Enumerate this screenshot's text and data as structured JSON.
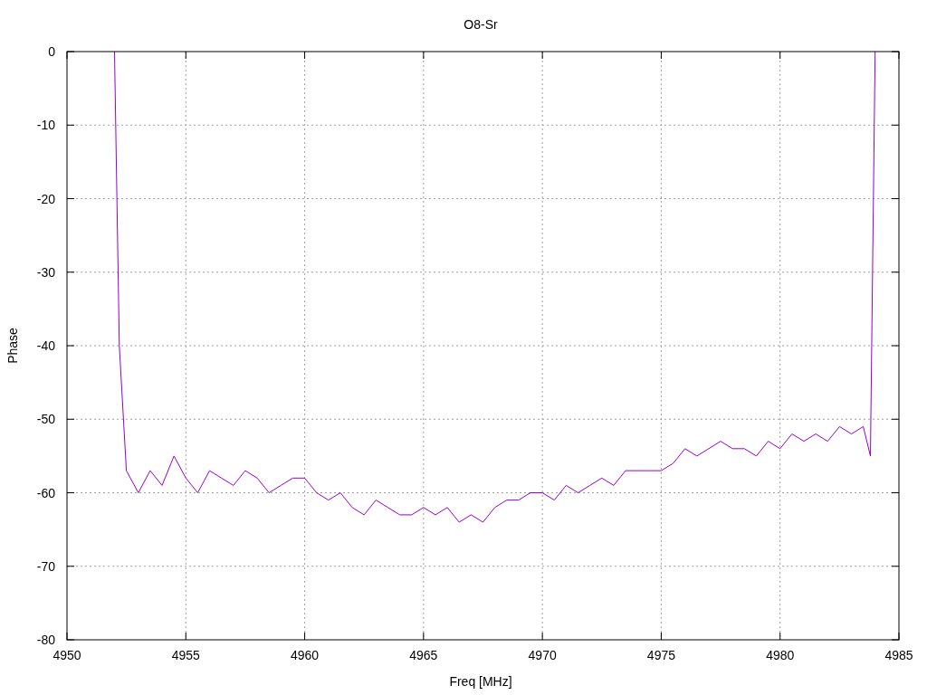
{
  "chart": {
    "chart_data": {
      "type": "line",
      "title": "O8-Sr",
      "xlabel": "Freq [MHz]",
      "ylabel": "Phase",
      "x": [
        4952.0,
        4952.2,
        4952.5,
        4953,
        4953.5,
        4954,
        4954.5,
        4955,
        4955.5,
        4956,
        4956.5,
        4957,
        4957.5,
        4958,
        4958.5,
        4959,
        4959.5,
        4960,
        4960.5,
        4961,
        4961.5,
        4962,
        4962.5,
        4963,
        4963.5,
        4964,
        4964.5,
        4965,
        4965.5,
        4966,
        4966.5,
        4967,
        4967.5,
        4968,
        4968.5,
        4969,
        4969.5,
        4970,
        4970.5,
        4971,
        4971.5,
        4972,
        4972.5,
        4973,
        4973.5,
        4974,
        4974.5,
        4975,
        4975.5,
        4976,
        4976.5,
        4977,
        4977.5,
        4978,
        4978.5,
        4979,
        4979.5,
        4980,
        4980.5,
        4981,
        4981.5,
        4982,
        4982.5,
        4983,
        4983.5,
        4983.8,
        4984.0
      ],
      "series": [
        {
          "color": "#9400d3",
          "values": [
            0,
            -40,
            -57,
            -60,
            -57,
            -59,
            -55,
            -58,
            -60,
            -57,
            -58,
            -59,
            -57,
            -58,
            -60,
            -59,
            -58,
            -58,
            -60,
            -61,
            -60,
            -62,
            -63,
            -61,
            -62,
            -63,
            -63,
            -62,
            -63,
            -62,
            -64,
            -63,
            -64,
            -62,
            -61,
            -61,
            -60,
            -60,
            -61,
            -59,
            -60,
            -59,
            -58,
            -59,
            -57,
            -57,
            -57,
            -57,
            -56,
            -54,
            -55,
            -54,
            -53,
            -54,
            -54,
            -55,
            -53,
            -54,
            -52,
            -53,
            -52,
            -53,
            -51,
            -52,
            -51,
            -55,
            0
          ]
        }
      ],
      "grid": true,
      "xlim": [
        4950,
        4985
      ],
      "ylim": [
        -80,
        0
      ],
      "xticks": [
        4950,
        4955,
        4960,
        4965,
        4970,
        4975,
        4980,
        4985
      ],
      "yticks": [
        -80,
        -70,
        -60,
        -50,
        -40,
        -30,
        -20,
        -10,
        0
      ]
    }
  }
}
